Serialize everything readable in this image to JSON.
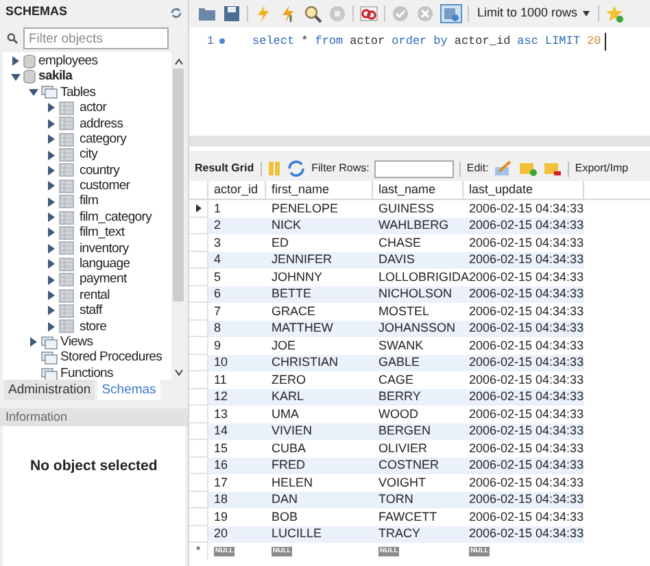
{
  "sidebar": {
    "title": "SCHEMAS",
    "filter": {
      "placeholder": "Filter objects"
    },
    "tree": [
      {
        "label": "employees",
        "kind": "schema",
        "expandable": true,
        "expanded": false
      },
      {
        "label": "sakila",
        "kind": "schema",
        "expandable": true,
        "expanded": true,
        "children": [
          {
            "label": "Tables",
            "kind": "folder",
            "expandable": true,
            "expanded": true,
            "children": [
              {
                "label": "actor",
                "kind": "table",
                "expandable": true,
                "expanded": false
              },
              {
                "label": "address",
                "kind": "table",
                "expandable": true,
                "expanded": false
              },
              {
                "label": "category",
                "kind": "table",
                "expandable": true,
                "expanded": false
              },
              {
                "label": "city",
                "kind": "table",
                "expandable": true,
                "expanded": false
              },
              {
                "label": "country",
                "kind": "table",
                "expandable": true,
                "expanded": false
              },
              {
                "label": "customer",
                "kind": "table",
                "expandable": true,
                "expanded": false
              },
              {
                "label": "film",
                "kind": "table",
                "expandable": true,
                "expanded": false
              },
              {
                "label": "film_category",
                "kind": "table",
                "expandable": true,
                "expanded": false
              },
              {
                "label": "film_text",
                "kind": "table",
                "expandable": true,
                "expanded": false
              },
              {
                "label": "inventory",
                "kind": "table",
                "expandable": true,
                "expanded": false
              },
              {
                "label": "language",
                "kind": "table",
                "expandable": true,
                "expanded": false
              },
              {
                "label": "payment",
                "kind": "table",
                "expandable": true,
                "expanded": false
              },
              {
                "label": "rental",
                "kind": "table",
                "expandable": true,
                "expanded": false
              },
              {
                "label": "staff",
                "kind": "table",
                "expandable": true,
                "expanded": false
              },
              {
                "label": "store",
                "kind": "table",
                "expandable": true,
                "expanded": false
              }
            ]
          },
          {
            "label": "Views",
            "kind": "folder",
            "expandable": true,
            "expanded": false
          },
          {
            "label": "Stored Procedures",
            "kind": "folder"
          },
          {
            "label": "Functions",
            "kind": "folder"
          }
        ]
      }
    ],
    "tabs": [
      {
        "label": "Administration",
        "selected": false
      },
      {
        "label": "Schemas",
        "selected": true
      }
    ],
    "info": {
      "title": "Information",
      "message": "No object selected"
    }
  },
  "editor": {
    "limit": "Limit to 1000 rows",
    "line_number": "1",
    "query": [
      {
        "text": "select",
        "kind": "keyword"
      },
      {
        "text": "*",
        "kind": "plain"
      },
      {
        "text": "from",
        "kind": "keyword"
      },
      {
        "text": "actor",
        "kind": "plain"
      },
      {
        "text": "order",
        "kind": "keyword"
      },
      {
        "text": "by",
        "kind": "keyword"
      },
      {
        "text": "actor_id",
        "kind": "plain"
      },
      {
        "text": "asc",
        "kind": "keyword"
      },
      {
        "text": "LIMIT",
        "kind": "keyword"
      },
      {
        "text": "20",
        "kind": "number"
      }
    ]
  },
  "results": {
    "tab": "Result Grid",
    "filter_label": "Filter Rows:",
    "edit_label": "Edit:",
    "export_label": "Export/Imp",
    "columns": [
      "actor_id",
      "first_name",
      "last_name",
      "last_update"
    ],
    "rows": [
      {
        "cells": [
          "1",
          "PENELOPE",
          "GUINESS",
          "2006-02-15 04:34:33"
        ],
        "current": true
      },
      {
        "cells": [
          "2",
          "NICK",
          "WAHLBERG",
          "2006-02-15 04:34:33"
        ],
        "current": false
      },
      {
        "cells": [
          "3",
          "ED",
          "CHASE",
          "2006-02-15 04:34:33"
        ],
        "current": false
      },
      {
        "cells": [
          "4",
          "JENNIFER",
          "DAVIS",
          "2006-02-15 04:34:33"
        ],
        "current": false
      },
      {
        "cells": [
          "5",
          "JOHNNY",
          "LOLLOBRIGIDA",
          "2006-02-15 04:34:33"
        ],
        "current": false
      },
      {
        "cells": [
          "6",
          "BETTE",
          "NICHOLSON",
          "2006-02-15 04:34:33"
        ],
        "current": false
      },
      {
        "cells": [
          "7",
          "GRACE",
          "MOSTEL",
          "2006-02-15 04:34:33"
        ],
        "current": false
      },
      {
        "cells": [
          "8",
          "MATTHEW",
          "JOHANSSON",
          "2006-02-15 04:34:33"
        ],
        "current": false
      },
      {
        "cells": [
          "9",
          "JOE",
          "SWANK",
          "2006-02-15 04:34:33"
        ],
        "current": false
      },
      {
        "cells": [
          "10",
          "CHRISTIAN",
          "GABLE",
          "2006-02-15 04:34:33"
        ],
        "current": false
      },
      {
        "cells": [
          "11",
          "ZERO",
          "CAGE",
          "2006-02-15 04:34:33"
        ],
        "current": false
      },
      {
        "cells": [
          "12",
          "KARL",
          "BERRY",
          "2006-02-15 04:34:33"
        ],
        "current": false
      },
      {
        "cells": [
          "13",
          "UMA",
          "WOOD",
          "2006-02-15 04:34:33"
        ],
        "current": false
      },
      {
        "cells": [
          "14",
          "VIVIEN",
          "BERGEN",
          "2006-02-15 04:34:33"
        ],
        "current": false
      },
      {
        "cells": [
          "15",
          "CUBA",
          "OLIVIER",
          "2006-02-15 04:34:33"
        ],
        "current": false
      },
      {
        "cells": [
          "16",
          "FRED",
          "COSTNER",
          "2006-02-15 04:34:33"
        ],
        "current": false
      },
      {
        "cells": [
          "17",
          "HELEN",
          "VOIGHT",
          "2006-02-15 04:34:33"
        ],
        "current": false
      },
      {
        "cells": [
          "18",
          "DAN",
          "TORN",
          "2006-02-15 04:34:33"
        ],
        "current": false
      },
      {
        "cells": [
          "19",
          "BOB",
          "FAWCETT",
          "2006-02-15 04:34:33"
        ],
        "current": false
      },
      {
        "cells": [
          "20",
          "LUCILLE",
          "TRACY",
          "2006-02-15 04:34:33"
        ],
        "current": false
      }
    ],
    "new_row": {
      "marker": "*",
      "cells": [
        "NULL",
        "NULL",
        "NULL",
        "NULL"
      ]
    }
  }
}
